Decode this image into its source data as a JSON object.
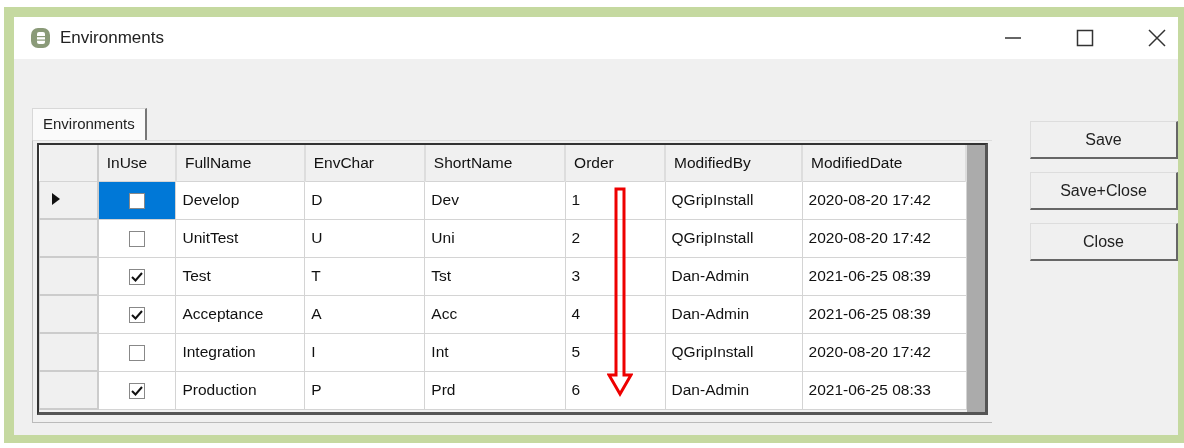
{
  "window": {
    "title": "Environments"
  },
  "tabs": [
    {
      "label": "Environments",
      "selected": true
    }
  ],
  "table": {
    "columns": [
      "InUse",
      "FullName",
      "EnvChar",
      "ShortName",
      "Order",
      "ModifiedBy",
      "ModifiedDate"
    ],
    "rows": [
      {
        "selected": true,
        "cells": [
          {
            "kind": "checkbox",
            "checked": false
          },
          "Develop",
          "D",
          "Dev",
          "1",
          "QGripInstall",
          "2020-08-20 17:42"
        ]
      },
      {
        "selected": false,
        "cells": [
          {
            "kind": "checkbox",
            "checked": false
          },
          "UnitTest",
          "U",
          "Uni",
          "2",
          "QGripInstall",
          "2020-08-20 17:42"
        ]
      },
      {
        "selected": false,
        "cells": [
          {
            "kind": "checkbox",
            "checked": true
          },
          "Test",
          "T",
          "Tst",
          "3",
          "Dan-Admin",
          "2021-06-25 08:39"
        ]
      },
      {
        "selected": false,
        "cells": [
          {
            "kind": "checkbox",
            "checked": true
          },
          "Acceptance",
          "A",
          "Acc",
          "4",
          "Dan-Admin",
          "2021-06-25 08:39"
        ]
      },
      {
        "selected": false,
        "cells": [
          {
            "kind": "checkbox",
            "checked": false
          },
          "Integration",
          "I",
          "Int",
          "5",
          "QGripInstall",
          "2020-08-20 17:42"
        ]
      },
      {
        "selected": false,
        "cells": [
          {
            "kind": "checkbox",
            "checked": true
          },
          "Production",
          "P",
          "Prd",
          "6",
          "Dan-Admin",
          "2021-06-25 08:33"
        ]
      }
    ]
  },
  "buttons": [
    "Save",
    "Save+Close",
    "Close"
  ]
}
